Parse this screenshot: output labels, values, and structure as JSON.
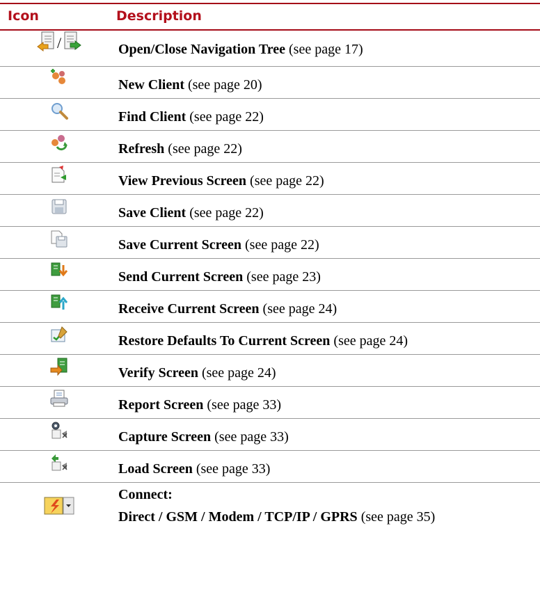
{
  "header": {
    "icon_col": "Icon",
    "desc_col": "Description"
  },
  "rows": [
    {
      "title": "Open/Close Navigation Tree",
      "ref": " (see page 17)",
      "icon": "open-close-navigation-tree-icon"
    },
    {
      "title": "New Client",
      "ref": " (see page 20)",
      "icon": "new-client-icon"
    },
    {
      "title": "Find Client",
      "ref": " (see page 22)",
      "icon": "find-client-icon"
    },
    {
      "title": "Refresh",
      "ref": " (see page 22)",
      "icon": "refresh-icon"
    },
    {
      "title": "View Previous Screen",
      "ref": " (see page 22)",
      "icon": "view-previous-screen-icon"
    },
    {
      "title": "Save Client",
      "ref": " (see page 22)",
      "icon": "save-client-icon"
    },
    {
      "title": "Save Current Screen",
      "ref": " (see page 22)",
      "icon": "save-current-screen-icon"
    },
    {
      "title": "Send Current Screen",
      "ref": " (see page 23)",
      "icon": "send-current-screen-icon"
    },
    {
      "title": "Receive Current Screen",
      "ref": " (see page 24)",
      "icon": "receive-current-screen-icon"
    },
    {
      "title": "Restore Defaults To Current Screen",
      "ref": " (see page 24)",
      "icon": "restore-defaults-icon"
    },
    {
      "title": "Verify Screen",
      "ref": " (see page 24)",
      "icon": "verify-screen-icon"
    },
    {
      "title": "Report Screen",
      "ref": " (see page 33)",
      "icon": "report-screen-icon"
    },
    {
      "title": "Capture Screen",
      "ref": " (see page 33)",
      "icon": "capture-screen-icon"
    },
    {
      "title": "Load Screen",
      "ref": " (see page 33)",
      "icon": "load-screen-icon"
    }
  ],
  "connect": {
    "title": "Connect:",
    "options": "Direct / GSM / Modem / TCP/IP / GPRS",
    "ref": " (see page 35)",
    "icon": "connect-dropdown-icon"
  },
  "slash": "/",
  "colors": {
    "header_red": "#b3101c",
    "rule_red": "#a50b17"
  }
}
